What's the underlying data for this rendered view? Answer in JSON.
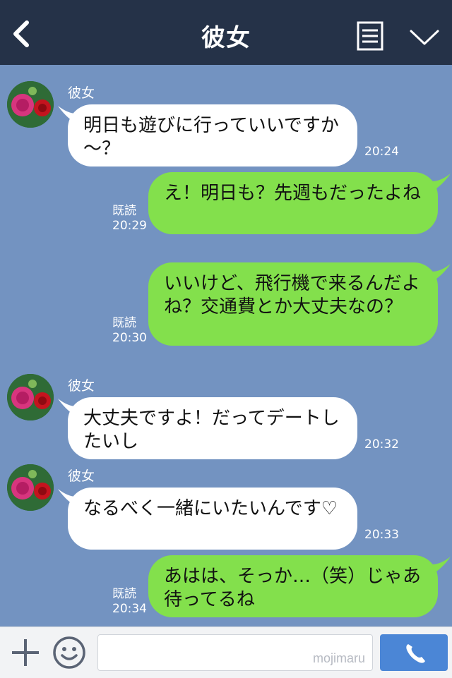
{
  "header": {
    "title": "彼女",
    "back_icon": "chevron-left-icon",
    "menu_icon": "menu-icon",
    "collapse_icon": "chevron-down-icon"
  },
  "messages": [
    {
      "direction": "in",
      "sender": "彼女",
      "text": "明日も遊びに行っていいですか～？",
      "time": "20:24"
    },
    {
      "direction": "out",
      "read": "既読",
      "text": "え！明日も？先週もだったよね",
      "time": "20:29"
    },
    {
      "direction": "out",
      "read": "既読",
      "text": "いいけど、飛行機で来るんだよね？交通費とか大丈夫なの？",
      "time": "20:30"
    },
    {
      "direction": "in",
      "sender": "彼女",
      "text": "大丈夫ですよ！だってデートしたいし",
      "time": "20:32"
    },
    {
      "direction": "in",
      "sender": "彼女",
      "text": "なるべく一緒にいたいんです♡",
      "time": "20:33"
    },
    {
      "direction": "out",
      "read": "既読",
      "text": "あはは、そっか…（笑）じゃあ待ってるね",
      "time": "20:34"
    }
  ],
  "footer": {
    "plus_icon": "plus-icon",
    "emoji_icon": "emoji-icon",
    "watermark": "mojimaru",
    "call_icon": "phone-icon"
  },
  "colors": {
    "header_bg": "#253248",
    "chat_bg": "#7393c1",
    "outgoing_bubble": "#83e04c",
    "incoming_bubble": "#ffffff",
    "call_button": "#4b86d6"
  }
}
